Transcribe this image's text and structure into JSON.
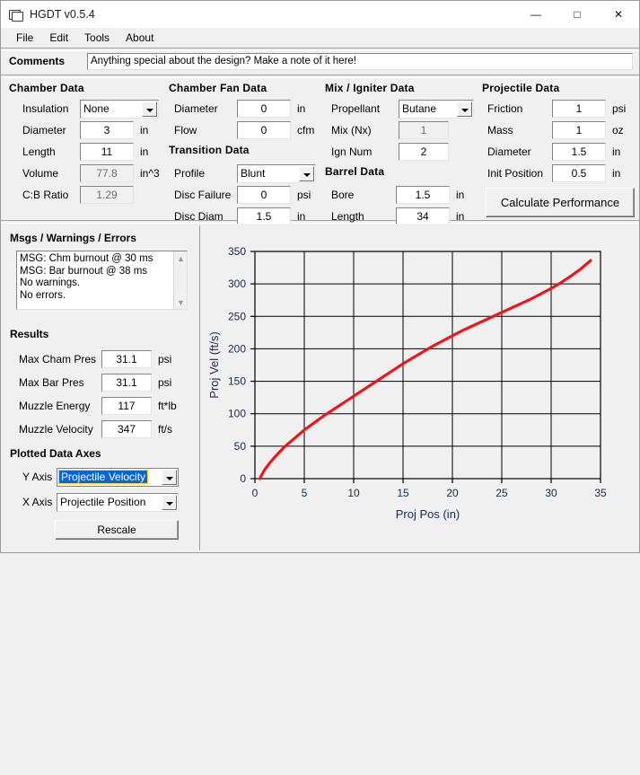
{
  "window": {
    "title": "HGDT v0.5.4",
    "icon": "application-window-icon",
    "minimize": "—",
    "maximize": "□",
    "close": "✕"
  },
  "menubar": {
    "items": [
      "File",
      "Edit",
      "Tools",
      "About"
    ]
  },
  "comments": {
    "label": "Comments",
    "value": "Anything special about the design?  Make a note of it here!"
  },
  "chamber_data": {
    "title": "Chamber Data",
    "fields": [
      {
        "label": "Insulation",
        "value": "None",
        "unit": "",
        "type": "combo",
        "readonly": false
      },
      {
        "label": "Diameter",
        "value": "3",
        "unit": "in",
        "type": "text",
        "readonly": false
      },
      {
        "label": "Length",
        "value": "11",
        "unit": "in",
        "type": "text",
        "readonly": false
      },
      {
        "label": "Volume",
        "value": "77.8",
        "unit": "in^3",
        "type": "text",
        "readonly": true
      },
      {
        "label": "C:B Ratio",
        "value": "1.29",
        "unit": "",
        "type": "text",
        "readonly": true
      }
    ]
  },
  "chamber_fan_data": {
    "title": "Chamber Fan Data",
    "fields": [
      {
        "label": "Diameter",
        "value": "0",
        "unit": "in",
        "type": "text",
        "readonly": false
      },
      {
        "label": "Flow",
        "value": "0",
        "unit": "cfm",
        "type": "text",
        "readonly": false
      }
    ]
  },
  "transition_data": {
    "title": "Transition Data",
    "fields": [
      {
        "label": "Profile",
        "value": "Blunt",
        "unit": "",
        "type": "combo",
        "readonly": false
      },
      {
        "label": "Disc Failure",
        "value": "0",
        "unit": "psi",
        "type": "text",
        "readonly": false
      },
      {
        "label": "Disc Diam",
        "value": "1.5",
        "unit": "in",
        "type": "text",
        "readonly": false
      }
    ]
  },
  "mix_igniter_data": {
    "title": "Mix / Igniter Data",
    "fields": [
      {
        "label": "Propellant",
        "value": "Butane",
        "unit": "",
        "type": "combo",
        "readonly": false
      },
      {
        "label": "Mix (Nx)",
        "value": "1",
        "unit": "",
        "type": "text",
        "readonly": true
      },
      {
        "label": "Ign Num",
        "value": "2",
        "unit": "",
        "type": "text",
        "readonly": false
      }
    ]
  },
  "barrel_data": {
    "title": "Barrel Data",
    "fields": [
      {
        "label": "Bore",
        "value": "1.5",
        "unit": "in",
        "type": "text",
        "readonly": false
      },
      {
        "label": "Length",
        "value": "34",
        "unit": "in",
        "type": "text",
        "readonly": false
      }
    ]
  },
  "projectile_data": {
    "title": "Projectile Data",
    "fields": [
      {
        "label": "Friction",
        "value": "1",
        "unit": "psi",
        "type": "text",
        "readonly": false
      },
      {
        "label": "Mass",
        "value": "1",
        "unit": "oz",
        "type": "text",
        "readonly": false
      },
      {
        "label": "Diameter",
        "value": "1.5",
        "unit": "in",
        "type": "text",
        "readonly": false
      },
      {
        "label": "Init Position",
        "value": "0.5",
        "unit": "in",
        "type": "text",
        "readonly": false
      }
    ],
    "calculate_button": "Calculate Performance"
  },
  "messages": {
    "title": "Msgs / Warnings / Errors",
    "lines": [
      "MSG: Chm burnout @ 30 ms",
      "MSG: Bar burnout @ 38 ms",
      "No warnings.",
      "No errors."
    ]
  },
  "results": {
    "title": "Results",
    "fields": [
      {
        "label": "Max Cham Pres",
        "value": "31.1",
        "unit": "psi"
      },
      {
        "label": "Max Bar Pres",
        "value": "31.1",
        "unit": "psi"
      },
      {
        "label": "Muzzle Energy",
        "value": "117",
        "unit": "ft*lb"
      },
      {
        "label": "Muzzle Velocity",
        "value": "347",
        "unit": "ft/s"
      }
    ]
  },
  "plotted_axes": {
    "title": "Plotted Data Axes",
    "y_label": "Y Axis",
    "y_value": "Projectile Velocity",
    "x_label": "X Axis",
    "x_value": "Projectile Position",
    "rescale_button": "Rescale"
  },
  "chart_data": {
    "type": "line",
    "title": "",
    "xlabel": "Proj Pos (in)",
    "ylabel": "Proj Vel (ft/s)",
    "xlim": [
      0,
      35
    ],
    "ylim": [
      0,
      350
    ],
    "xticks": [
      0,
      5,
      10,
      15,
      20,
      25,
      30,
      35
    ],
    "yticks": [
      0,
      50,
      100,
      150,
      200,
      250,
      300,
      350
    ],
    "grid": true,
    "legend": "none",
    "series": [
      {
        "name": "Projectile Velocity",
        "color": "#e8191b",
        "x": [
          0.5,
          0.7,
          1.0,
          1.5,
          2.0,
          2.5,
          3.0,
          4.0,
          5.0,
          6.0,
          7.0,
          8.0,
          9.0,
          10.0,
          11.0,
          12.0,
          13.0,
          14.0,
          15.0,
          16.0,
          17.0,
          18.0,
          19.0,
          20.0,
          21.0,
          22.0,
          23.0,
          24.0,
          25.0,
          26.0,
          27.0,
          28.0,
          29.0,
          30.0,
          31.0,
          32.0,
          33.0,
          34.0
        ],
        "y": [
          0,
          6,
          14,
          24,
          33,
          41,
          49,
          62,
          75,
          86,
          97,
          107,
          117,
          127,
          137,
          147,
          157,
          167,
          177,
          186,
          195,
          204,
          212,
          220,
          228,
          235,
          242,
          249,
          256,
          263,
          270,
          277,
          285,
          293,
          302,
          312,
          323,
          336
        ]
      }
    ]
  }
}
